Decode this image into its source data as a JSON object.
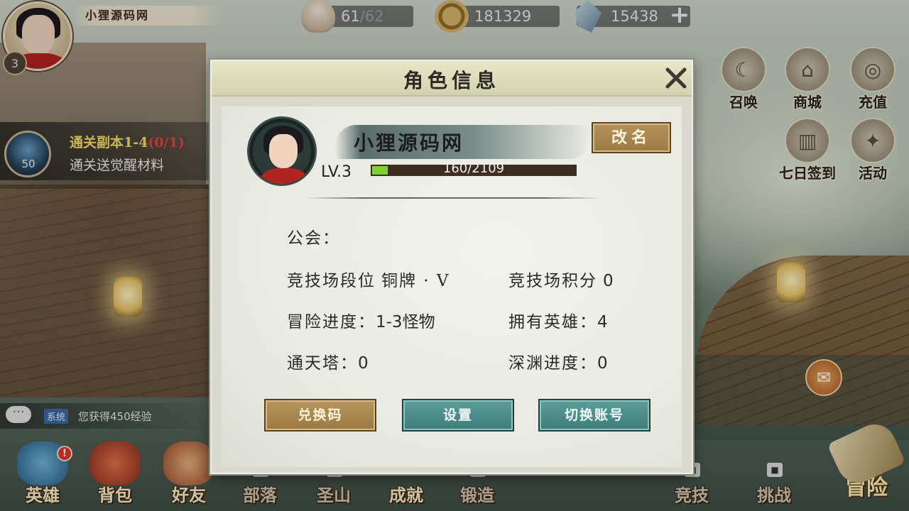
{
  "player": {
    "name": "小狸源码网",
    "level_badge": "3"
  },
  "resources": {
    "stamina_current": "61",
    "stamina_max": "/62",
    "gold": "181329",
    "gems": "15438",
    "add_label": "+"
  },
  "side_buttons": [
    {
      "label": "召唤",
      "icon": "summon-icon"
    },
    {
      "label": "商城",
      "icon": "shop-icon"
    },
    {
      "label": "充值",
      "icon": "recharge-icon"
    },
    {
      "label": "七日签到",
      "icon": "seven-day-signin-icon"
    },
    {
      "label": "活动",
      "icon": "event-icon"
    }
  ],
  "quest": {
    "title": "通关副本1-4",
    "progress": "(0/1)",
    "description": "通关送觉醒材料",
    "icon_count": "50"
  },
  "chat": {
    "tag": "系统",
    "message": "您获得450经验"
  },
  "bottom_nav": [
    {
      "label": "英雄",
      "icon": "hero-icon",
      "locked": false
    },
    {
      "label": "背包",
      "icon": "bag-icon",
      "locked": false
    },
    {
      "label": "好友",
      "icon": "friends-icon",
      "locked": false
    },
    {
      "label": "部落",
      "icon": "tribe-icon",
      "locked": true
    },
    {
      "label": "圣山",
      "icon": "holy-mountain-icon",
      "locked": true
    },
    {
      "label": "成就",
      "icon": "achievement-icon",
      "locked": false
    },
    {
      "label": "锻造",
      "icon": "forge-icon",
      "locked": true
    },
    {
      "label": "竞技",
      "icon": "arena-icon",
      "locked": true
    },
    {
      "label": "挑战",
      "icon": "challenge-icon",
      "locked": true
    },
    {
      "label": "冒险",
      "icon": "adventure-icon",
      "locked": false
    }
  ],
  "hero_alert": "!",
  "dialog": {
    "title": "角色信息",
    "close_label": "✕",
    "name": "小狸源码网",
    "rename_label": "改名",
    "level": "LV.3",
    "exp_text": "160/2109",
    "exp_fraction": 0.076,
    "guild_label": "公会：",
    "arena_rank_label": "竞技场段位",
    "arena_rank_value": "铜牌 · V",
    "arena_points_label": "竞技场积分",
    "arena_points_value": "0",
    "adventure_label": "冒险进度：",
    "adventure_value": "1-3怪物",
    "heroes_label": "拥有英雄：",
    "heroes_value": "4",
    "tower_label": "通天塔：",
    "tower_value": "0",
    "abyss_label": "深渊进度：",
    "abyss_value": "0",
    "redeem_label": "兑换码",
    "settings_label": "设置",
    "switch_account_label": "切换账号"
  },
  "colors": {
    "exp_fill": "#7fd23c",
    "quest_title": "#f6df66",
    "quest_progress": "#e8433a",
    "gold_button": "#b8965f",
    "teal_button": "#5d9d9a"
  }
}
